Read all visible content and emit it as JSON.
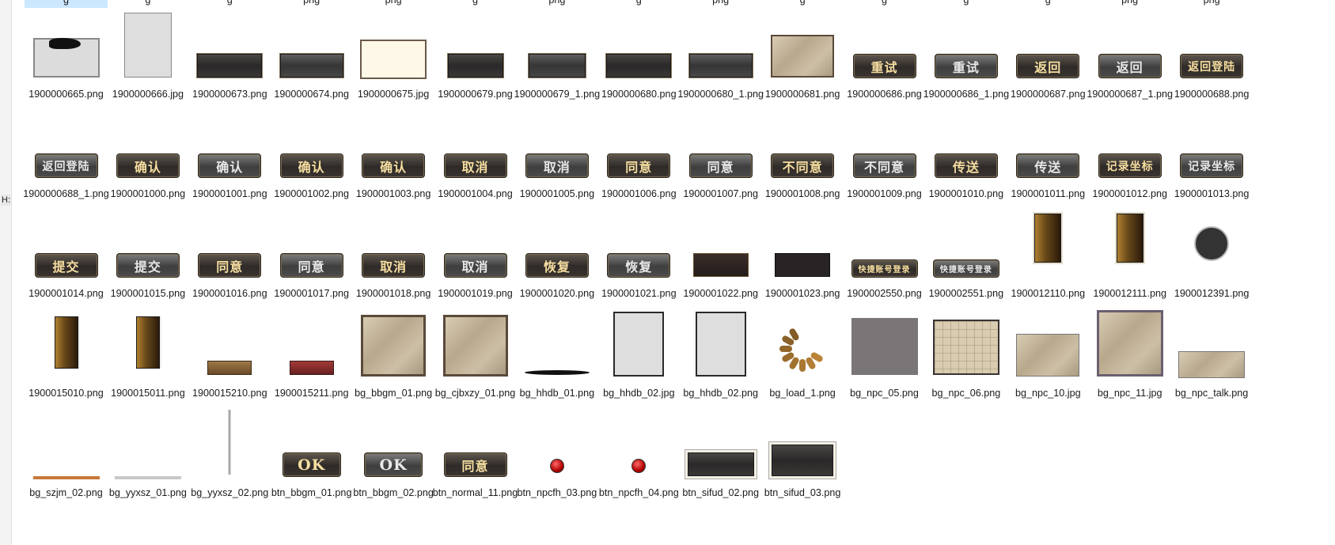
{
  "window": {
    "side_label": "H:"
  },
  "top_row_captions": [
    "g",
    "g",
    "g",
    "png",
    "png",
    "g",
    "png",
    "g",
    "png",
    "g",
    "g",
    "g",
    "g",
    "png",
    "png"
  ],
  "files": [
    {
      "name": "1900000665.png",
      "thumb": "frame-ink"
    },
    {
      "name": "1900000666.jpg",
      "thumb": "paper-tall"
    },
    {
      "name": "1900000673.png",
      "thumb": "panel-dark"
    },
    {
      "name": "1900000674.png",
      "thumb": "panel-gray"
    },
    {
      "name": "1900000675.jpg",
      "thumb": "paper-cream"
    },
    {
      "name": "1900000679.png",
      "thumb": "panel-dark-small"
    },
    {
      "name": "1900000679_1.png",
      "thumb": "panel-gray-small"
    },
    {
      "name": "1900000680.png",
      "thumb": "panel-dark"
    },
    {
      "name": "1900000680_1.png",
      "thumb": "panel-gray"
    },
    {
      "name": "1900000681.png",
      "thumb": "photo-wide"
    },
    {
      "name": "1900000686.png",
      "thumb": "btn-gold",
      "label": "重试"
    },
    {
      "name": "1900000686_1.png",
      "thumb": "btn-gray",
      "label": "重试"
    },
    {
      "name": "1900000687.png",
      "thumb": "btn-gold",
      "label": "返回"
    },
    {
      "name": "1900000687_1.png",
      "thumb": "btn-gray",
      "label": "返回"
    },
    {
      "name": "1900000688.png",
      "thumb": "btn-gold",
      "label": "返回登陆"
    },
    {
      "name": "1900000688_1.png",
      "thumb": "btn-gray",
      "label": "返回登陆"
    },
    {
      "name": "1900001000.png",
      "thumb": "btn-gold",
      "label": "确认"
    },
    {
      "name": "1900001001.png",
      "thumb": "btn-gray",
      "label": "确认"
    },
    {
      "name": "1900001002.png",
      "thumb": "btn-gold",
      "label": "确认"
    },
    {
      "name": "1900001003.png",
      "thumb": "btn-gold",
      "label": "确认"
    },
    {
      "name": "1900001004.png",
      "thumb": "btn-gold",
      "label": "取消"
    },
    {
      "name": "1900001005.png",
      "thumb": "btn-gray",
      "label": "取消"
    },
    {
      "name": "1900001006.png",
      "thumb": "btn-gold",
      "label": "同意"
    },
    {
      "name": "1900001007.png",
      "thumb": "btn-gray",
      "label": "同意"
    },
    {
      "name": "1900001008.png",
      "thumb": "btn-gold",
      "label": "不同意"
    },
    {
      "name": "1900001009.png",
      "thumb": "btn-gray",
      "label": "不同意"
    },
    {
      "name": "1900001010.png",
      "thumb": "btn-gold",
      "label": "传送"
    },
    {
      "name": "1900001011.png",
      "thumb": "btn-gray",
      "label": "传送"
    },
    {
      "name": "1900001012.png",
      "thumb": "btn-gold",
      "label": "记录坐标"
    },
    {
      "name": "1900001013.png",
      "thumb": "btn-gray",
      "label": "记录坐标"
    },
    {
      "name": "1900001014.png",
      "thumb": "btn-gold",
      "label": "提交"
    },
    {
      "name": "1900001015.png",
      "thumb": "btn-gray",
      "label": "提交"
    },
    {
      "name": "1900001016.png",
      "thumb": "btn-gold",
      "label": "同意"
    },
    {
      "name": "1900001017.png",
      "thumb": "btn-gray",
      "label": "同意"
    },
    {
      "name": "1900001018.png",
      "thumb": "btn-gold",
      "label": "取消"
    },
    {
      "name": "1900001019.png",
      "thumb": "btn-gray",
      "label": "取消"
    },
    {
      "name": "1900001020.png",
      "thumb": "btn-gold",
      "label": "恢复"
    },
    {
      "name": "1900001021.png",
      "thumb": "btn-gray",
      "label": "恢复"
    },
    {
      "name": "1900001022.png",
      "thumb": "panel-brown"
    },
    {
      "name": "1900001023.png",
      "thumb": "panel-black"
    },
    {
      "name": "1900002550.png",
      "thumb": "btn-long-gold",
      "label": "快捷账号登录"
    },
    {
      "name": "1900002551.png",
      "thumb": "btn-long-gray",
      "label": "快捷账号登录"
    },
    {
      "name": "1900012110.png",
      "thumb": "vbar-tall"
    },
    {
      "name": "1900012111.png",
      "thumb": "vbar-tall"
    },
    {
      "name": "1900012391.png",
      "thumb": "circle-dark"
    },
    {
      "name": "1900015010.png",
      "thumb": "vbar-mid"
    },
    {
      "name": "1900015011.png",
      "thumb": "vbar-mid"
    },
    {
      "name": "1900015210.png",
      "thumb": "bar-bronze"
    },
    {
      "name": "1900015211.png",
      "thumb": "bar-red"
    },
    {
      "name": "bg_bbgm_01.png",
      "thumb": "photo-square"
    },
    {
      "name": "bg_cjbxzy_01.png",
      "thumb": "photo-square"
    },
    {
      "name": "bg_hhdb_01.png",
      "thumb": "ink-line"
    },
    {
      "name": "bg_hhdb_02.jpg",
      "thumb": "paper-framed"
    },
    {
      "name": "bg_hhdb_02.png",
      "thumb": "paper-framed"
    },
    {
      "name": "bg_load_1.png",
      "thumb": "spinner"
    },
    {
      "name": "bg_npc_05.png",
      "thumb": "gray-block"
    },
    {
      "name": "bg_npc_06.png",
      "thumb": "grid-block"
    },
    {
      "name": "bg_npc_10.jpg",
      "thumb": "photo-wide-light"
    },
    {
      "name": "bg_npc_11.jpg",
      "thumb": "photo-framed"
    },
    {
      "name": "bg_npc_talk.png",
      "thumb": "photo-strip"
    },
    {
      "name": "bg_szjm_02.png",
      "thumb": "line-orange"
    },
    {
      "name": "bg_yyxsz_01.png",
      "thumb": "line-gray"
    },
    {
      "name": "bg_yyxsz_02.png",
      "thumb": "vline"
    },
    {
      "name": "btn_bbgm_01.png",
      "thumb": "btn-ok-gold",
      "label": "OK"
    },
    {
      "name": "btn_bbgm_02.png",
      "thumb": "btn-ok-gray",
      "label": "OK"
    },
    {
      "name": "btn_normal_11.png",
      "thumb": "btn-gold",
      "label": "同意"
    },
    {
      "name": "btn_npcfh_03.png",
      "thumb": "red-dot"
    },
    {
      "name": "btn_npcfh_04.png",
      "thumb": "red-dot"
    },
    {
      "name": "btn_sifud_02.png",
      "thumb": "panel-dark-framed"
    },
    {
      "name": "btn_sifud_03.png",
      "thumb": "panel-dark-framed-lg"
    }
  ],
  "colors": {
    "selection": "#cce8ff",
    "gold_text": "#f6dea0",
    "gray_text": "#e8e8e8"
  }
}
